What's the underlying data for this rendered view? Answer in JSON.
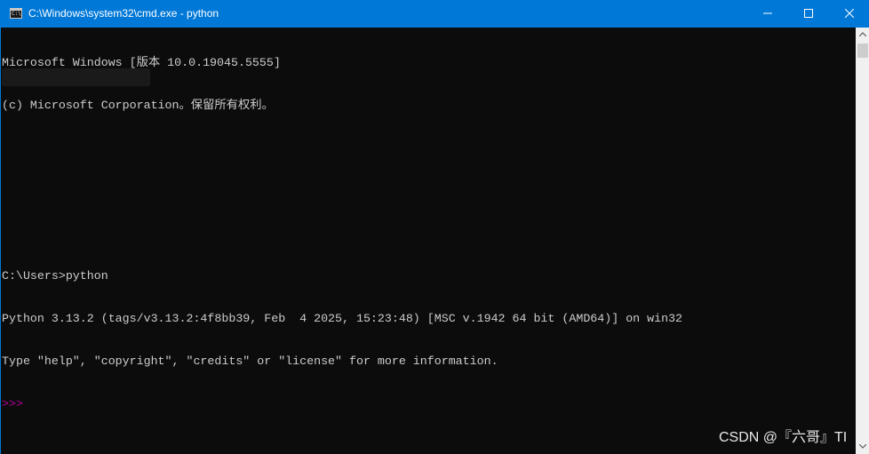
{
  "window": {
    "title": "C:\\Windows\\system32\\cmd.exe - python",
    "icon": "cmd-icon",
    "accent_color": "#0078d7"
  },
  "controls": {
    "minimize_icon": "minimize-icon",
    "maximize_icon": "maximize-icon",
    "close_icon": "close-icon"
  },
  "console": {
    "background": "#0c0c0c",
    "foreground": "#cccccc",
    "lines": [
      "Microsoft Windows [版本 10.0.19045.5555]",
      "(c) Microsoft Corporation。保留所有权利。",
      "",
      "",
      "",
      "C:\\Users>python",
      "Python 3.13.2 (tags/v3.13.2:4f8bb39, Feb  4 2025, 15:23:48) [MSC v.1942 64 bit (AMD64)] on win32",
      "Type \"help\", \"copyright\", \"credits\" or \"license\" for more information."
    ],
    "repl_prompt": ">>>",
    "repl_prompt_color": "#b6009c"
  },
  "watermark": {
    "text": "CSDN @『六哥』TI"
  }
}
